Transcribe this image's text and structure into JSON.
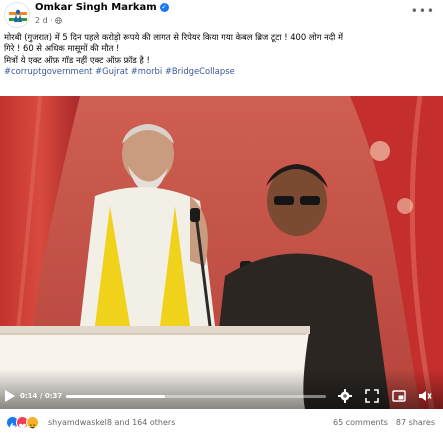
{
  "post": {
    "author": "Omkar Singh Markam",
    "time": "2 d",
    "privacy_icon": "globe-icon",
    "text_lines": [
      "मोरबी (गुजरात) में 5 दिन पहले करोड़ो रूपये की लागत से रिपेयर किया गया केबल ब्रिज टूटा ! 400 लोग नदी में",
      "गिरे ! 60 से अधिक मासूमों की मौत !",
      "मित्रों ये एक्ट ऑफ़ गॉड नहीं एक्ट ऑफ़ फ्रॉड है !"
    ],
    "hashtags": "#corruptgovernment #Gujrat #morbi #BridgeCollapse"
  },
  "video": {
    "time": "0:14 / 0:37",
    "progress": 0.38,
    "icons": [
      "play-icon",
      "settings-icon",
      "fullscreen-icon",
      "miniplayer-icon",
      "volume-icon"
    ]
  },
  "footer": {
    "reactions_text": "shyamdwaskel8 and 164 others",
    "reaction_icons": [
      "like-icon",
      "love-icon",
      "haha-icon"
    ],
    "comments": "65 comments",
    "shares": "87 shares"
  },
  "colors": {
    "link": "#385898",
    "brand": "#1877f2",
    "muted": "#65676b"
  }
}
